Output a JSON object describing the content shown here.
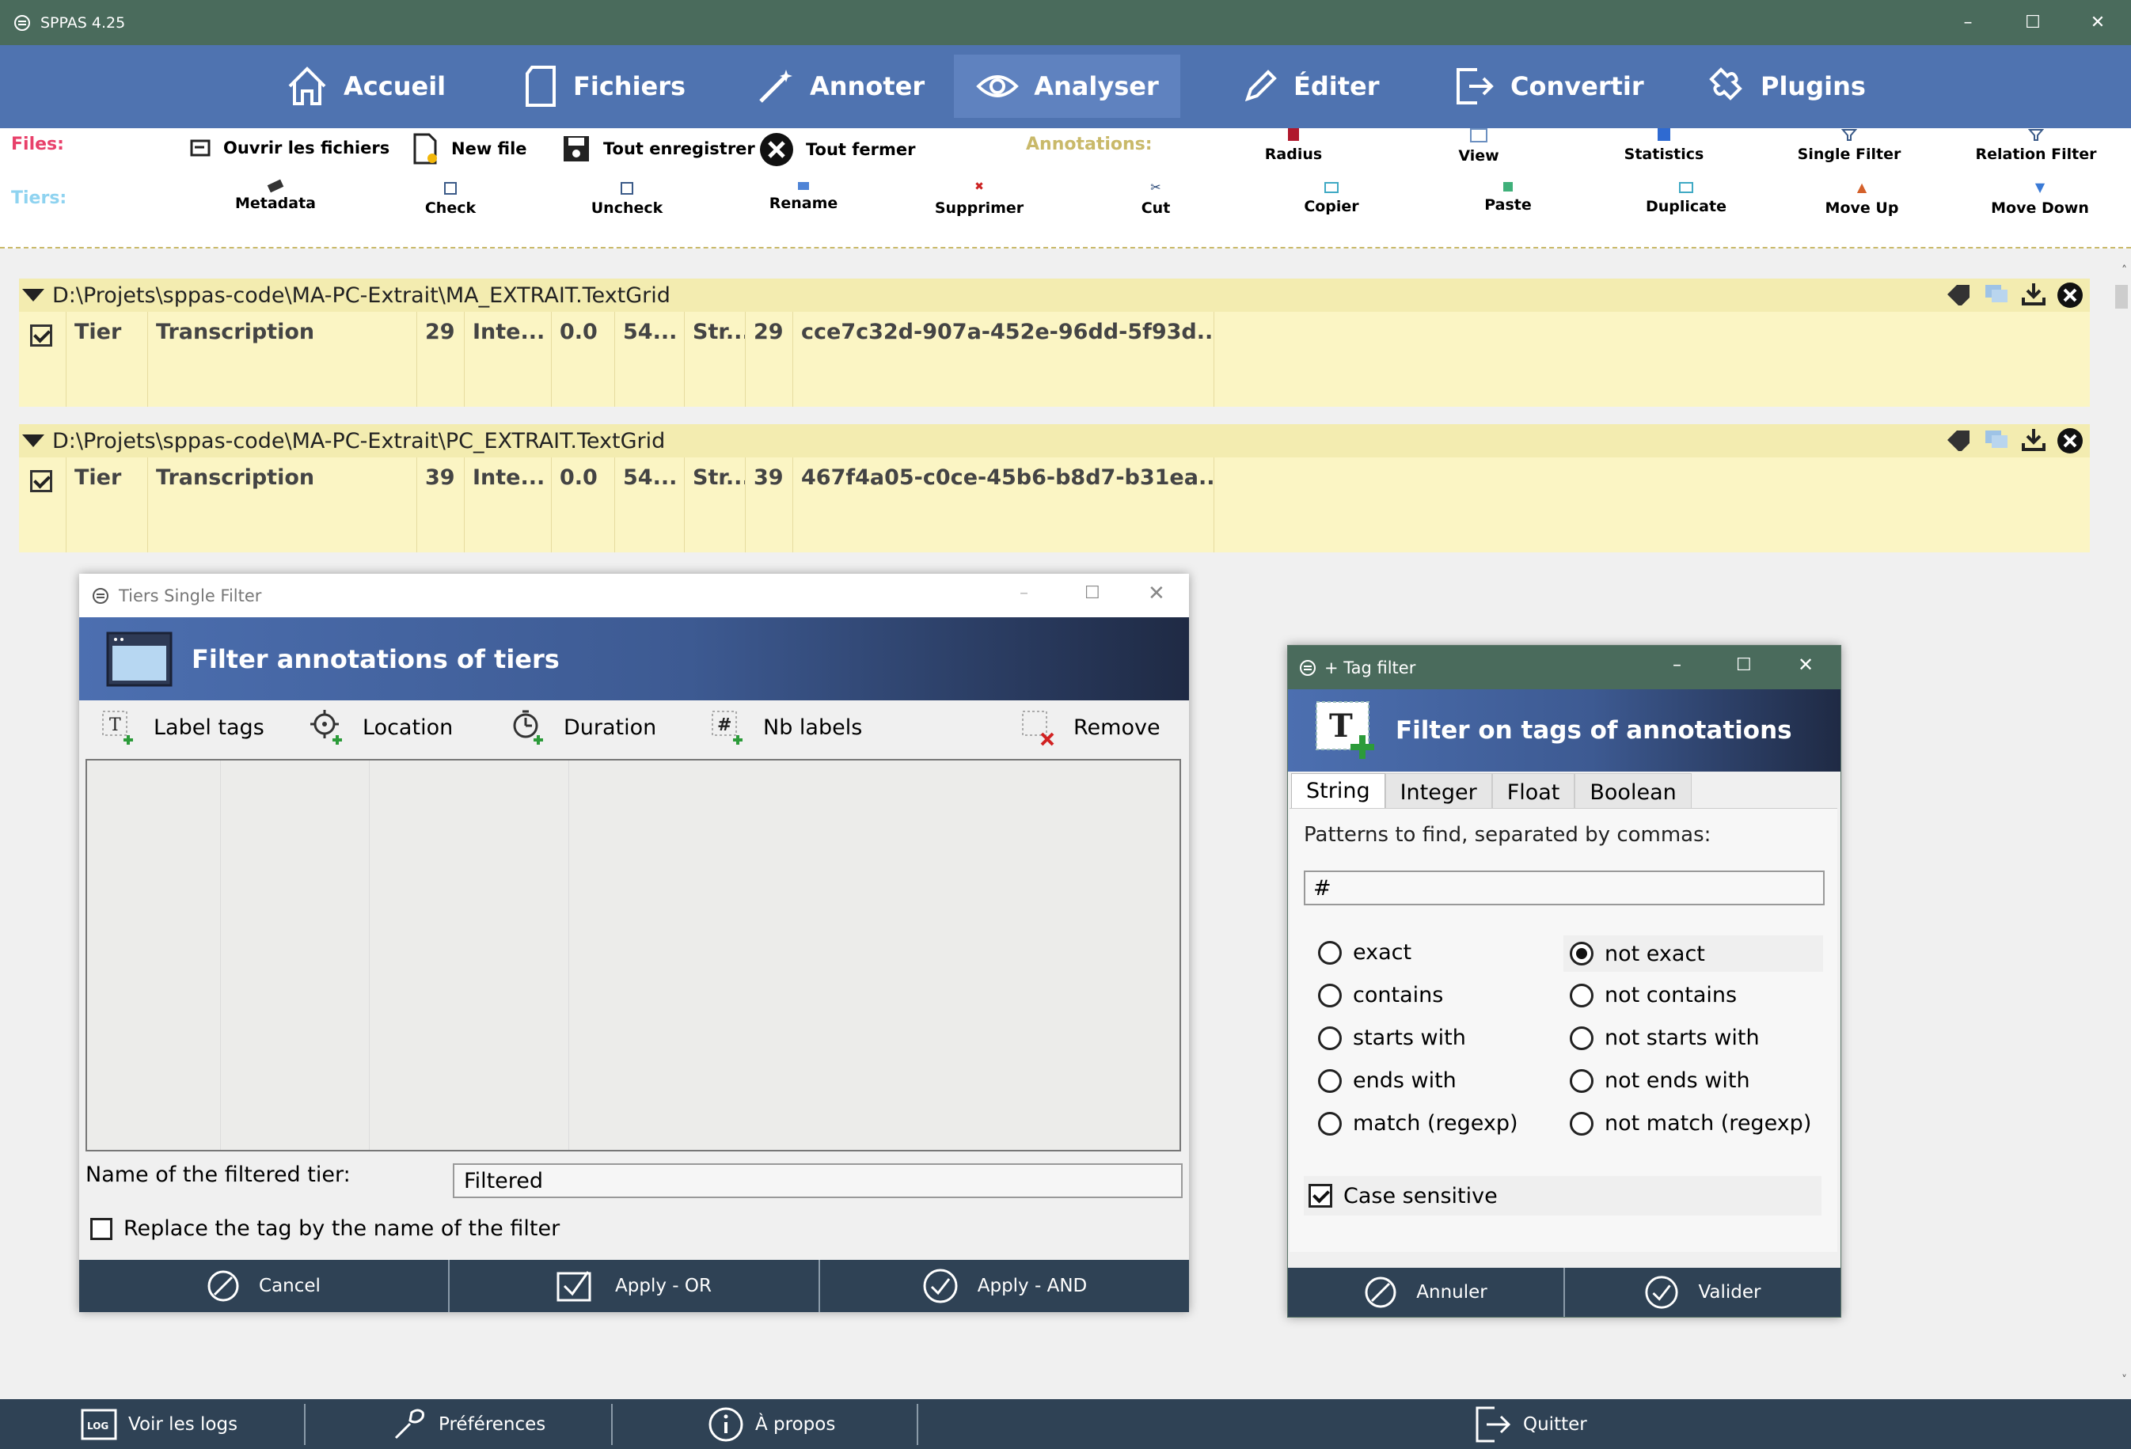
{
  "window": {
    "title": "SPPAS 4.25",
    "minimize": "–",
    "maximize": "☐",
    "close": "✕"
  },
  "nav": {
    "items": [
      {
        "label": "Accueil",
        "icon": "home-icon"
      },
      {
        "label": "Fichiers",
        "icon": "file-icon"
      },
      {
        "label": "Annoter",
        "icon": "wand-icon"
      },
      {
        "label": "Analyser",
        "icon": "eye-icon",
        "active": true
      },
      {
        "label": "Éditer",
        "icon": "pencil-icon"
      },
      {
        "label": "Convertir",
        "icon": "export-icon"
      },
      {
        "label": "Plugins",
        "icon": "puzzle-icon"
      }
    ]
  },
  "toolbar": {
    "files_label": "Files:",
    "tiers_label": "Tiers:",
    "annotations_label": "Annotations:",
    "open_files": "Ouvrir les fichiers",
    "new_file": "New file",
    "save_all": "Tout enregistrer",
    "close_all": "Tout fermer",
    "radius": "Radius",
    "view": "View",
    "statistics": "Statistics",
    "single_filter": "Single Filter",
    "relation_filter": "Relation Filter",
    "metadata": "Metadata",
    "check": "Check",
    "uncheck": "Uncheck",
    "rename": "Rename",
    "supprimer": "Supprimer",
    "cut": "Cut",
    "copier": "Copier",
    "paste": "Paste",
    "duplicate": "Duplicate",
    "move_up": "Move Up",
    "move_down": "Move Down"
  },
  "files": [
    {
      "path": "D:\\Projets\\sppas-code\\MA-PC-Extrait\\MA_EXTRAIT.TextGrid",
      "row": {
        "kind": "Tier",
        "name": "Transcription",
        "count": "29",
        "type": "Inte...",
        "start": "0.0",
        "end": "54...",
        "loc": "Str...",
        "nb": "29",
        "id": "cce7c32d-907a-452e-96dd-5f93d..."
      }
    },
    {
      "path": "D:\\Projets\\sppas-code\\MA-PC-Extrait\\PC_EXTRAIT.TextGrid",
      "row": {
        "kind": "Tier",
        "name": "Transcription",
        "count": "39",
        "type": "Inte...",
        "start": "0.0",
        "end": "54...",
        "loc": "Str...",
        "nb": "39",
        "id": "467f4a05-c0ce-45b6-b8d7-b31ea..."
      }
    }
  ],
  "single_filter_dialog": {
    "title": "Tiers Single Filter",
    "header": "Filter annotations of tiers",
    "tabs": {
      "label_tags": "Label tags",
      "location": "Location",
      "duration": "Duration",
      "nb_labels": "Nb labels",
      "remove": "Remove"
    },
    "name_label": "Name of the filtered tier:",
    "name_value": "Filtered",
    "replace_label": "Replace the tag by the name of the filter",
    "cancel": "Cancel",
    "apply_or": "Apply - OR",
    "apply_and": "Apply - AND"
  },
  "tag_filter_dialog": {
    "title": "+ Tag filter",
    "header": "Filter on tags of annotations",
    "tabs": [
      "String",
      "Integer",
      "Float",
      "Boolean"
    ],
    "patterns_label": "Patterns to find, separated by commas:",
    "patterns_value": "#",
    "options_left": [
      "exact",
      "contains",
      "starts with",
      "ends with",
      "match (regexp)"
    ],
    "options_right": [
      "not exact",
      "not contains",
      "not starts with",
      "not ends with",
      "not match (regexp)"
    ],
    "selected": "not exact",
    "case_sensitive": "Case sensitive",
    "cancel": "Annuler",
    "ok": "Valider"
  },
  "bottom": {
    "logs": "Voir les logs",
    "preferences": "Préférences",
    "about": "À propos",
    "quit": "Quitter"
  },
  "colors": {
    "titlebar": "#4a6b5c",
    "nav": "#4f73b0",
    "footer": "#2f4255",
    "file_bg": "#fbf5c4",
    "files_label": "#e8406a",
    "tiers_label": "#8fd3f0",
    "annotations_label": "#c9b96a"
  }
}
